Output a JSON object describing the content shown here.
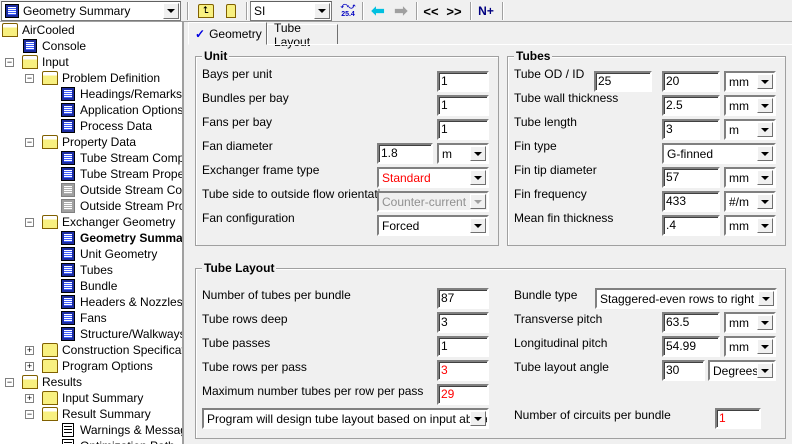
{
  "toolbar": {
    "nav_combo": "Geometry Summary",
    "units_combo": "SI",
    "units_icon_text": "25.4",
    "prev_label": "<<",
    "next_label": ">>",
    "next_input_label": "N+"
  },
  "tree": [
    {
      "label": "AirCooled",
      "level": 0,
      "icon": "folder-open",
      "expander": ""
    },
    {
      "label": "Console",
      "level": 1,
      "icon": "page",
      "expander": ""
    },
    {
      "label": "Input",
      "level": 1,
      "icon": "folder-open",
      "expander": "-"
    },
    {
      "label": "Problem Definition",
      "level": 2,
      "icon": "folder-open",
      "expander": "-"
    },
    {
      "label": "Headings/Remarks",
      "level": 3,
      "icon": "page",
      "expander": ""
    },
    {
      "label": "Application Options",
      "level": 3,
      "icon": "page",
      "expander": ""
    },
    {
      "label": "Process Data",
      "level": 3,
      "icon": "page",
      "expander": ""
    },
    {
      "label": "Property Data",
      "level": 2,
      "icon": "folder-open",
      "expander": "-"
    },
    {
      "label": "Tube Stream Compos",
      "level": 3,
      "icon": "page",
      "expander": ""
    },
    {
      "label": "Tube Stream Propert",
      "level": 3,
      "icon": "page",
      "expander": ""
    },
    {
      "label": "Outside Stream Comp",
      "level": 3,
      "icon": "page-gray",
      "expander": ""
    },
    {
      "label": "Outside Stream Prope",
      "level": 3,
      "icon": "page-gray",
      "expander": ""
    },
    {
      "label": "Exchanger Geometry",
      "level": 2,
      "icon": "folder-open",
      "expander": "-"
    },
    {
      "label": "Geometry Summary",
      "level": 3,
      "icon": "page",
      "expander": "",
      "bold": true
    },
    {
      "label": "Unit Geometry",
      "level": 3,
      "icon": "page",
      "expander": ""
    },
    {
      "label": "Tubes",
      "level": 3,
      "icon": "page",
      "expander": ""
    },
    {
      "label": "Bundle",
      "level": 3,
      "icon": "page",
      "expander": ""
    },
    {
      "label": "Headers & Nozzles",
      "level": 3,
      "icon": "page",
      "expander": ""
    },
    {
      "label": "Fans",
      "level": 3,
      "icon": "page",
      "expander": ""
    },
    {
      "label": "Structure/Walkways",
      "level": 3,
      "icon": "page",
      "expander": ""
    },
    {
      "label": "Construction Specificatio",
      "level": 2,
      "icon": "folder",
      "expander": "+"
    },
    {
      "label": "Program Options",
      "level": 2,
      "icon": "folder",
      "expander": "+"
    },
    {
      "label": "Results",
      "level": 1,
      "icon": "folder-open",
      "expander": "-"
    },
    {
      "label": "Input Summary",
      "level": 2,
      "icon": "folder",
      "expander": "+"
    },
    {
      "label": "Result Summary",
      "level": 2,
      "icon": "folder-open",
      "expander": "-"
    },
    {
      "label": "Warnings & Message",
      "level": 3,
      "icon": "doc",
      "expander": ""
    },
    {
      "label": "Optimization Path",
      "level": 3,
      "icon": "doc",
      "expander": ""
    }
  ],
  "tabs": [
    {
      "label": "Geometry",
      "checked": true
    },
    {
      "label": "Tube Layout"
    }
  ],
  "unit": {
    "title": "Unit",
    "bays_label": "Bays per unit",
    "bays": "1",
    "bundles_label": "Bundles per bay",
    "bundles": "1",
    "fans_label": "Fans per bay",
    "fans": "1",
    "fan_dia_label": "Fan diameter",
    "fan_dia": "1.8",
    "fan_dia_unit": "m",
    "frame_label": "Exchanger frame type",
    "frame": "Standard",
    "orient_label": "Tube side to outside flow orientation",
    "orient": "Counter-current",
    "fan_config_label": "Fan configuration",
    "fan_config": "Forced"
  },
  "tubes": {
    "title": "Tubes",
    "od_id_label": "Tube OD / ID",
    "od": "25",
    "id": "20",
    "od_unit": "mm",
    "wall_label": "Tube wall thickness",
    "wall": "2.5",
    "wall_unit": "mm",
    "length_label": "Tube length",
    "length": "3",
    "length_unit": "m",
    "fin_type_label": "Fin type",
    "fin_type": "G-finned",
    "fin_tip_label": "Fin tip diameter",
    "fin_tip": "57",
    "fin_tip_unit": "mm",
    "fin_freq_label": "Fin frequency",
    "fin_freq": "433",
    "fin_freq_unit": "#/m",
    "fin_thk_label": "Mean fin thickness",
    "fin_thk": ".4",
    "fin_thk_unit": "mm"
  },
  "layout": {
    "title": "Tube Layout",
    "ntubes_label": "Number of tubes per bundle",
    "ntubes": "87",
    "rows_label": "Tube rows deep",
    "rows": "3",
    "passes_label": "Tube passes",
    "passes": "1",
    "rows_pass_label": "Tube rows per pass",
    "rows_pass": "3",
    "max_label": "Maximum number tubes per row per pass",
    "max": "29",
    "design_mode": "Program will design tube layout based on input above",
    "bundle_type_label": "Bundle type",
    "bundle_type": "Staggered-even rows to right",
    "trans_label": "Transverse pitch",
    "trans": "63.5",
    "trans_unit": "mm",
    "long_label": "Longitudinal pitch",
    "long": "54.99",
    "long_unit": "mm",
    "angle_label": "Tube layout angle",
    "angle": "30",
    "angle_unit": "Degrees",
    "circuits_label": "Number of circuits per bundle",
    "circuits": "1"
  }
}
